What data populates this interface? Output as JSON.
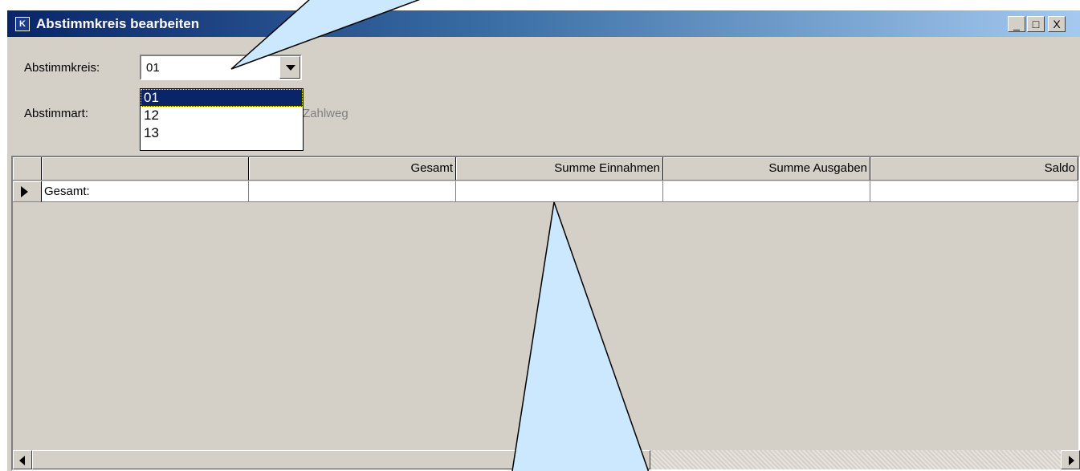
{
  "window": {
    "title": "Abstimmkreis bearbeiten",
    "app_icon": "K",
    "controls": {
      "minimize": "_",
      "maximize": "□",
      "close": "X"
    }
  },
  "form": {
    "abstimmkreis_label": "Abstimmkreis:",
    "abstimmkreis_value": "01",
    "abstimmkreis_options": [
      "01",
      "12",
      "13"
    ],
    "abstimmart_label": "Abstimmart:",
    "abstimmart_partial": "Zahlweg"
  },
  "grid": {
    "columns": [
      "",
      "Gesamt",
      "Summe Einnahmen",
      "Summe Ausgaben",
      "Saldo"
    ],
    "rows": [
      {
        "label": "Gesamt:",
        "gesamt": "",
        "einnahmen": "",
        "ausgaben": "",
        "saldo": ""
      }
    ]
  },
  "colors": {
    "callout_fill": "#cce8ff",
    "selection": "#0a246a",
    "window_bg": "#d4d0c8"
  }
}
